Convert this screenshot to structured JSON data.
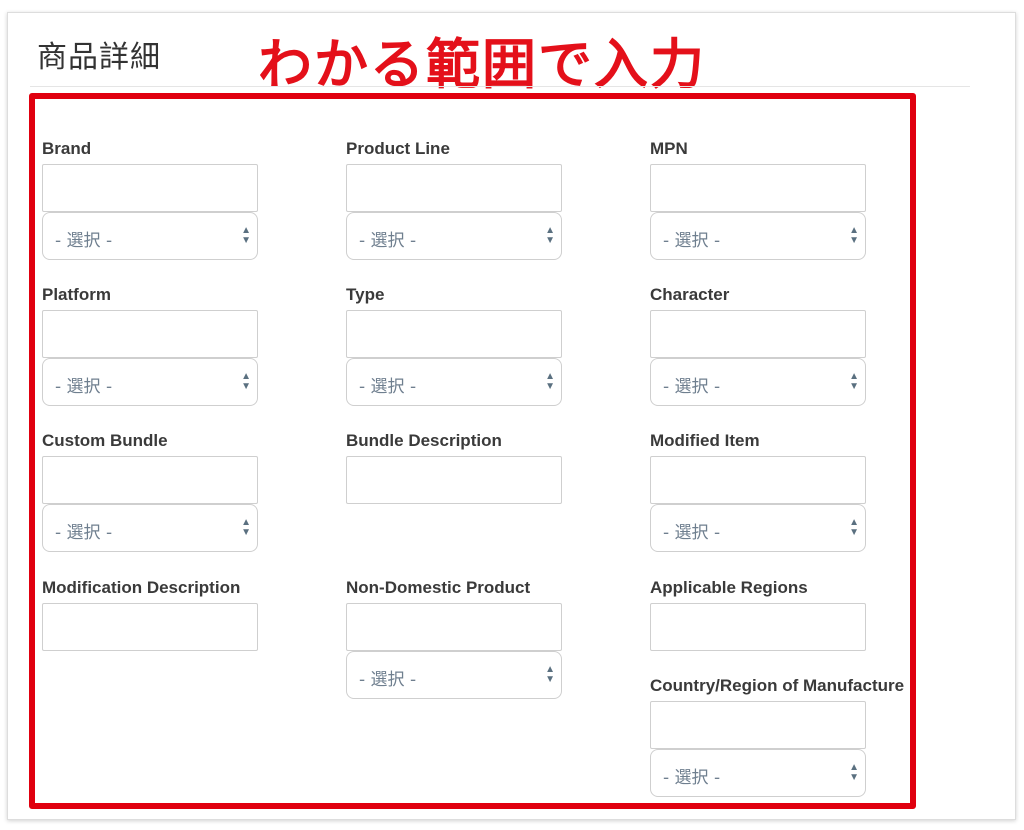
{
  "section": {
    "title": "商品詳細",
    "annotation": "わかる範囲で入力"
  },
  "fields": [
    {
      "label": "Brand",
      "select": "- 選択 -"
    },
    {
      "label": "Product Line",
      "select": "- 選択 -"
    },
    {
      "label": "MPN",
      "select": "- 選択 -"
    },
    {
      "label": "Platform",
      "select": "- 選択 -"
    },
    {
      "label": "Type",
      "select": "- 選択 -"
    },
    {
      "label": "Character",
      "select": "- 選択 -"
    },
    {
      "label": "Custom Bundle",
      "select": "- 選択 -"
    },
    {
      "label": "Bundle Description",
      "select": null
    },
    {
      "label": "Modified Item",
      "select": "- 選択 -"
    },
    {
      "label": "Modification Description",
      "select": null
    },
    {
      "label": "Non-Domestic Product",
      "select": "- 選択 -"
    },
    {
      "label": "Applicable Regions",
      "select": null
    },
    {
      "label": "Country/Region of Manufacture",
      "select": "- 選択 -"
    }
  ],
  "colors": {
    "annotation": "#e4101a",
    "highlight_border": "#e0000f"
  }
}
